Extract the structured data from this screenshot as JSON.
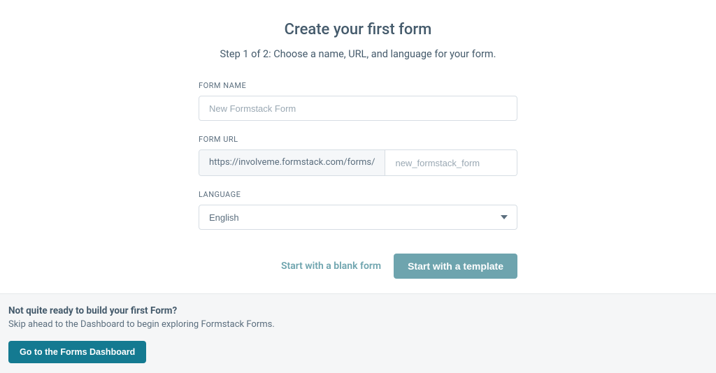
{
  "header": {
    "title": "Create your first form",
    "subtitle": "Step 1 of 2: Choose a name, URL, and language for your form."
  },
  "form": {
    "name": {
      "label": "FORM NAME",
      "placeholder": "New Formstack Form",
      "value": ""
    },
    "url": {
      "label": "FORM URL",
      "prefix": "https://involveme.formstack.com/forms/",
      "placeholder": "new_formstack_form",
      "value": ""
    },
    "language": {
      "label": "LANGUAGE",
      "selected": "English"
    }
  },
  "actions": {
    "blank_label": "Start with a blank form",
    "template_label": "Start with a template"
  },
  "footer": {
    "heading": "Not quite ready to build your first Form?",
    "text": "Skip ahead to the Dashboard to begin exploring Formstack Forms.",
    "button_label": "Go to the Forms Dashboard"
  }
}
